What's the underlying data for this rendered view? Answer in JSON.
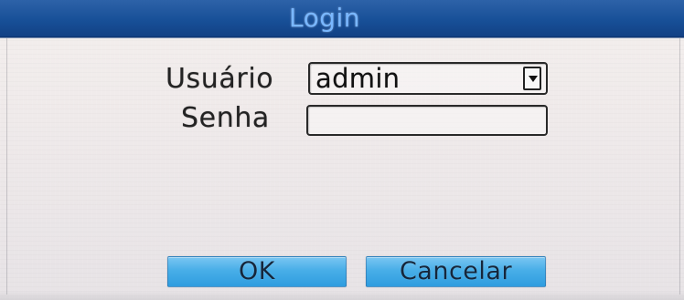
{
  "window": {
    "title": "Login"
  },
  "login_form": {
    "username_label": "Usuário",
    "username_value": "admin",
    "password_label": "Senha",
    "password_value": ""
  },
  "actions": {
    "ok_label": "OK",
    "cancel_label": "Cancelar"
  },
  "icons": {
    "dropdown": "chevron-down-icon"
  },
  "colors": {
    "title_bar": "#174f97",
    "title_text": "#79b7ff",
    "button": "#48aee8",
    "background": "#f0ebec",
    "text": "#232323"
  }
}
